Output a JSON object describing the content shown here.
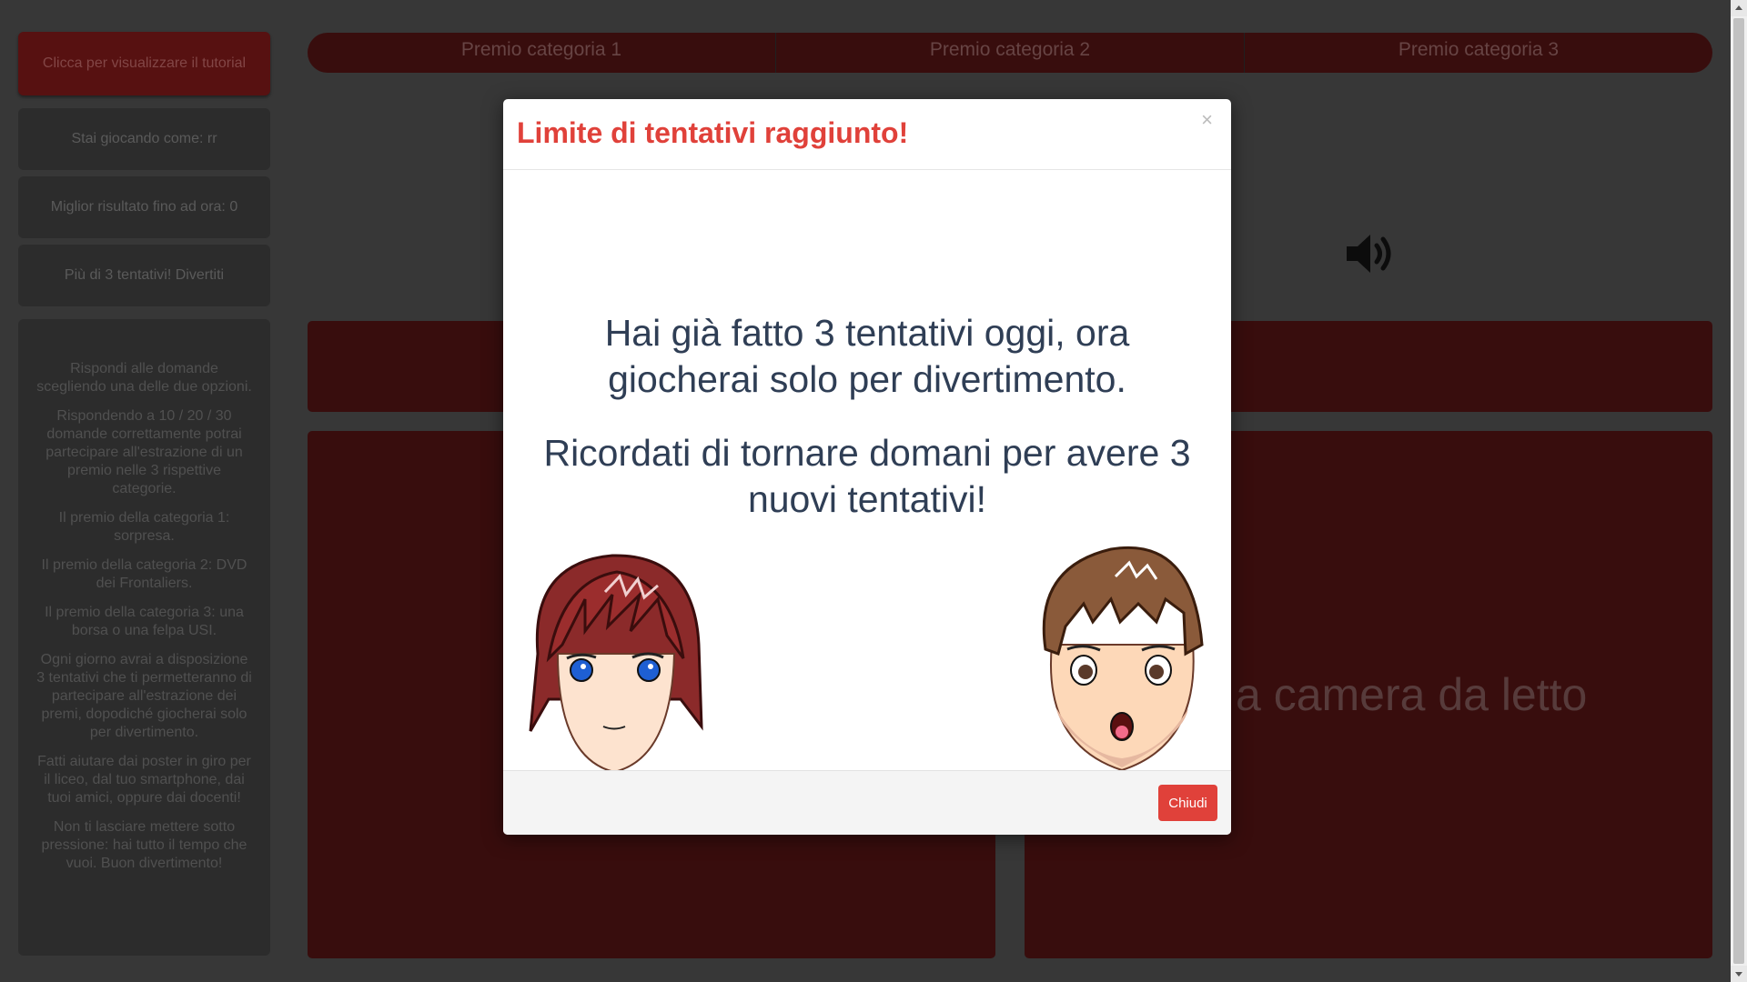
{
  "sidebar": {
    "tutorial_button": "Clicca per visualizzare il tutorial",
    "playing_as": "Stai giocando come: rr",
    "best_score": "Miglior risultato fino ad ora: 0",
    "attempts_info": "Più di 3 tentativi! Divertiti",
    "rules": [
      "Rispondi alle domande scegliendo una delle due opzioni.",
      "Rispondendo a 10 / 20 / 30 domande correttamente potrai partecipare all'estrazione di un premio nelle 3 rispettive categorie.",
      "Il premio della categoria 1: sorpresa.",
      "Il premio della categoria 2: DVD dei Frontaliers.",
      "Il premio della categoria 3: una borsa o una felpa USI.",
      "Ogni giorno avrai a disposizione 3 tentativi che ti permetteranno di partecipare all'estrazione dei premi, dopodiché giocherai solo per divertimento.",
      "Fatti aiutare dai poster in giro per il liceo, dal tuo smartphone, dai tuoi amici, oppure dai docenti!",
      "Non ti lasciare mettere sotto pressione: hai tutto il tempo che vuoi. Buon divertimento!"
    ]
  },
  "prizes": [
    "Premio categoria 1",
    "Premio categoria 2",
    "Premio categoria 3"
  ],
  "background": {
    "answer_option_right": "a camera da letto"
  },
  "icons": {
    "speaker": "speaker-icon",
    "close": "close-icon"
  },
  "modal": {
    "title": "Limite di tentativi raggiunto!",
    "close_symbol": "×",
    "message_1": "Hai già fatto 3 tentativi oggi, ora giocherai solo per divertimento.",
    "message_2": "Ricordati di tornare domani per avere 3 nuovi tentativi!",
    "close_button": "Chiudi"
  },
  "colors": {
    "title_red": "#e0413a",
    "button_red": "#e0413a",
    "dark_red": "#3b0e0e",
    "text_navy": "#2f3e55"
  }
}
